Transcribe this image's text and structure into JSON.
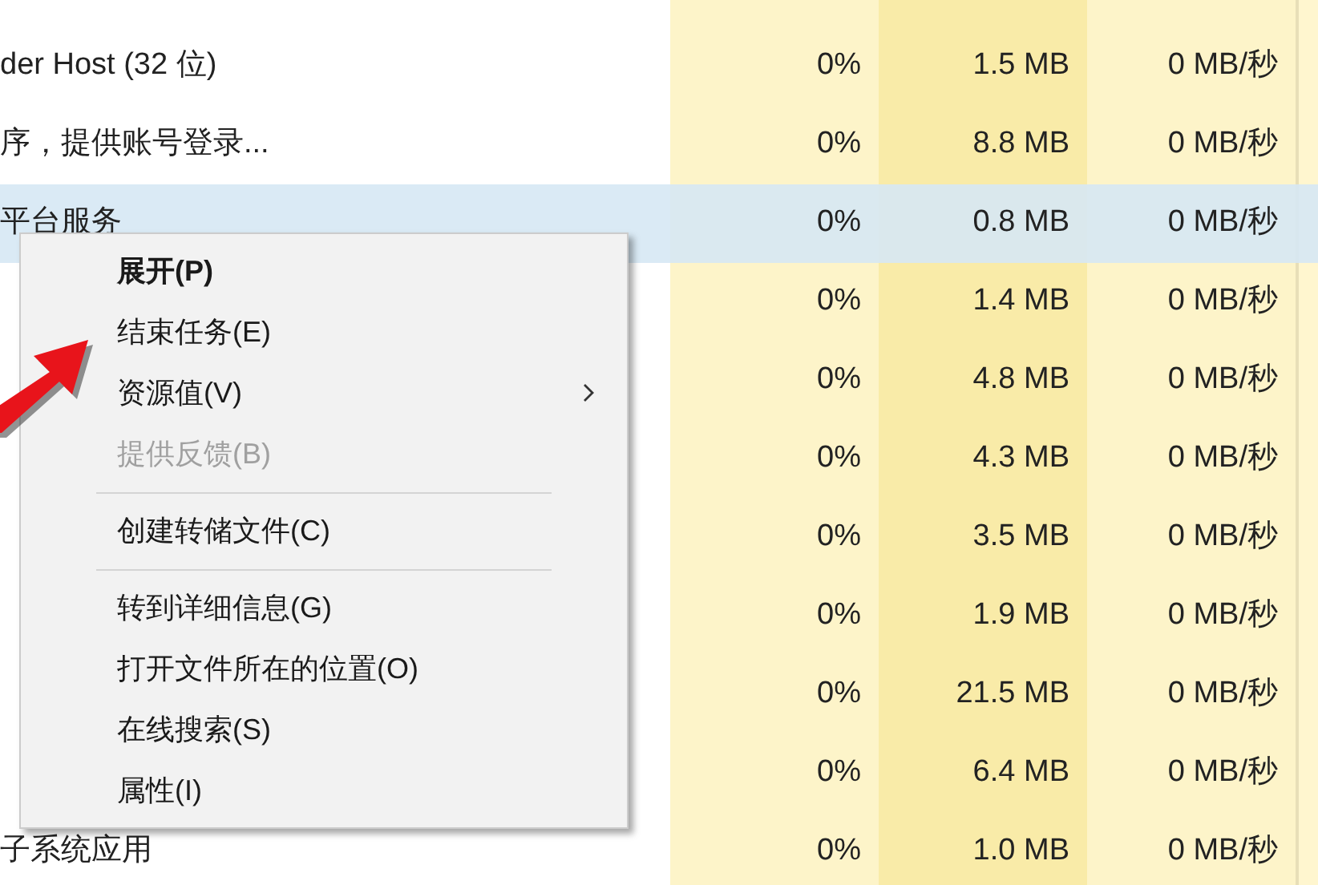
{
  "process_table": {
    "rows": [
      {
        "name": "der Host (32 位)",
        "cpu": "0%",
        "memory": "1.5 MB",
        "disk": "0 MB/秒",
        "selected": false
      },
      {
        "name": "序，提供账号登录...",
        "cpu": "0%",
        "memory": "8.8 MB",
        "disk": "0 MB/秒",
        "selected": false
      },
      {
        "name": "平台服务",
        "cpu": "0%",
        "memory": "0.8 MB",
        "disk": "0 MB/秒",
        "selected": true
      },
      {
        "cpu": "0%",
        "memory": "1.4 MB",
        "disk": "0 MB/秒",
        "selected": false
      },
      {
        "cpu": "0%",
        "memory": "4.8 MB",
        "disk": "0 MB/秒",
        "selected": false
      },
      {
        "cpu": "0%",
        "memory": "4.3 MB",
        "disk": "0 MB/秒",
        "selected": false
      },
      {
        "cpu": "0%",
        "memory": "3.5 MB",
        "disk": "0 MB/秒",
        "selected": false
      },
      {
        "cpu": "0%",
        "memory": "1.9 MB",
        "disk": "0 MB/秒",
        "selected": false
      },
      {
        "cpu": "0%",
        "memory": "21.5 MB",
        "disk": "0 MB/秒",
        "selected": false
      },
      {
        "cpu": "0%",
        "memory": "6.4 MB",
        "disk": "0 MB/秒",
        "selected": false
      },
      {
        "name": "子系统应用",
        "cpu": "0%",
        "memory": "1.0 MB",
        "disk": "0 MB/秒",
        "selected": false
      }
    ]
  },
  "context_menu": {
    "items": [
      {
        "kind": "item",
        "label": "展开(P)",
        "default": true,
        "disabled": false,
        "submenu": false
      },
      {
        "kind": "item",
        "label": "结束任务(E)",
        "default": false,
        "disabled": false,
        "submenu": false
      },
      {
        "kind": "item",
        "label": "资源值(V)",
        "default": false,
        "disabled": false,
        "submenu": true
      },
      {
        "kind": "item",
        "label": "提供反馈(B)",
        "default": false,
        "disabled": true,
        "submenu": false
      },
      {
        "kind": "separator"
      },
      {
        "kind": "item",
        "label": "创建转储文件(C)",
        "default": false,
        "disabled": false,
        "submenu": false
      },
      {
        "kind": "separator"
      },
      {
        "kind": "item",
        "label": "转到详细信息(G)",
        "default": false,
        "disabled": false,
        "submenu": false
      },
      {
        "kind": "item",
        "label": "打开文件所在的位置(O)",
        "default": false,
        "disabled": false,
        "submenu": false
      },
      {
        "kind": "item",
        "label": "在线搜索(S)",
        "default": false,
        "disabled": false,
        "submenu": false
      },
      {
        "kind": "item",
        "label": "属性(I)",
        "default": false,
        "disabled": false,
        "submenu": false
      }
    ]
  }
}
